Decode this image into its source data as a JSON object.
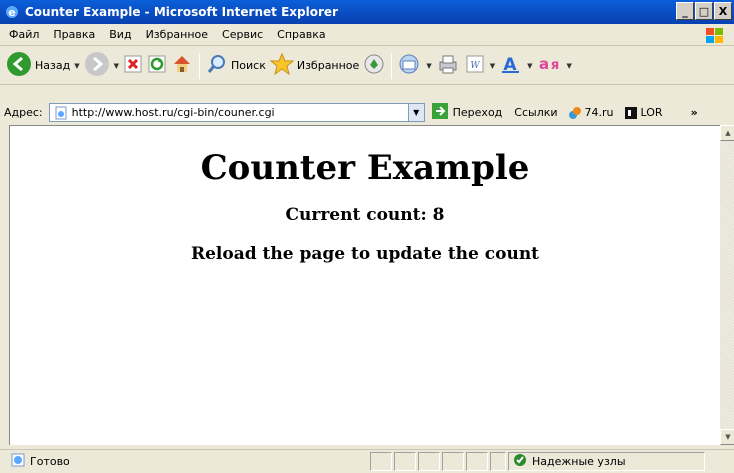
{
  "window": {
    "title": "Counter Example - Microsoft Internet Explorer",
    "min": "_",
    "max": "□",
    "close": "X"
  },
  "menu": {
    "items": [
      "Файл",
      "Правка",
      "Вид",
      "Избранное",
      "Сервис",
      "Справка"
    ]
  },
  "toolbar": {
    "back_label": "Назад",
    "search_label": "Поиск",
    "favorites_label": "Избранное"
  },
  "address": {
    "label": "Адрес:",
    "url": "http://www.host.ru/cgi-bin/couner.cgi",
    "go_label": "Переход"
  },
  "links": {
    "label": "Ссылки",
    "items": [
      "74.ru",
      "LOR"
    ],
    "more": "»"
  },
  "page": {
    "heading": "Counter Example",
    "count_text": "Current count: 8",
    "reload_text": "Reload the page to update the count"
  },
  "status": {
    "text": "Готово",
    "zone": "Надежные узлы"
  },
  "colors": {
    "titlebar": "#0a4ec4",
    "zone_check": "#2b8a2b"
  }
}
